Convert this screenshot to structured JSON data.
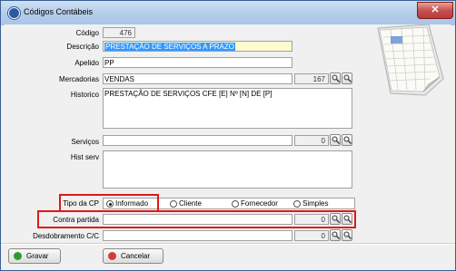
{
  "window": {
    "title": "Códigos Contábeis",
    "close_label": "✕"
  },
  "form": {
    "codigo": {
      "label": "Código",
      "value": "476"
    },
    "descricao": {
      "label": "Descrição",
      "value": "PRESTAÇÃO DE SERVIÇOS A PRAZO"
    },
    "apelido": {
      "label": "Apelido",
      "value": "PP"
    },
    "mercadorias": {
      "label": "Mercadorias",
      "value": "VENDAS",
      "code": "167"
    },
    "historico": {
      "label": "Historico",
      "value": "PRESTAÇÃO DE SERVIÇOS CFE [E] Nº [N] DE [P]"
    },
    "servicos": {
      "label": "Serviços",
      "value": "",
      "code": "0"
    },
    "hist_serv": {
      "label": "Hist serv",
      "value": ""
    },
    "tipo_cp": {
      "label": "Tipo da CP",
      "options": [
        "Informado",
        "Cliente",
        "Fornecedor",
        "Simples"
      ],
      "selected": "Informado"
    },
    "contra_partida": {
      "label": "Contra partida",
      "value": "",
      "code": "0"
    },
    "desdobramento": {
      "label": "Desdobramento C/C",
      "value": "",
      "code": "0"
    }
  },
  "buttons": {
    "gravar": "Gravar",
    "cancelar": "Cancelar"
  },
  "colors": {
    "highlight": "#e01818",
    "selection": "#3399ff",
    "accent_field": "#fffbd0"
  }
}
